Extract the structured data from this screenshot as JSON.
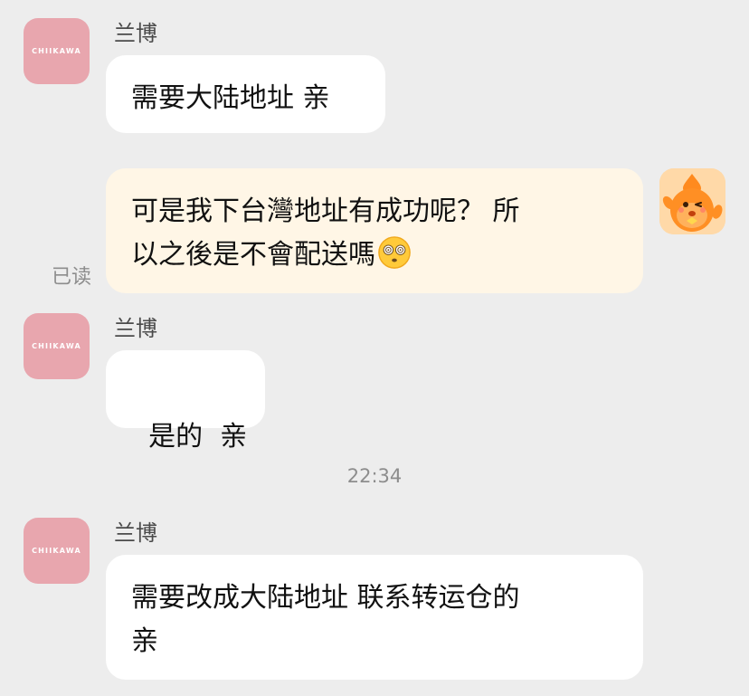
{
  "messages": [
    {
      "sender": "兰博",
      "avatar_text": "CHIIKAWA",
      "text": "需要大陆地址 亲"
    },
    {
      "text_line1": "可是我下台灣地址有成功呢？ 所",
      "text_line2": "以之後是不會配送嗎",
      "emoji": "dizzy-face-emoji",
      "read_status": "已读"
    },
    {
      "sender": "兰博",
      "avatar_text": "CHIIKAWA",
      "text": "是的  亲"
    },
    {
      "time": "22:34"
    },
    {
      "sender": "兰博",
      "avatar_text": "CHIIKAWA",
      "text_line1": "需要改成大陆地址 联系转运仓的",
      "text_line2": "亲"
    }
  ],
  "colors": {
    "background": "#ededed",
    "incoming_bubble": "#ffffff",
    "outgoing_bubble": "#fff6e6",
    "avatar_pink": "#e8a6ae",
    "meta_text": "#8d8d8d"
  }
}
